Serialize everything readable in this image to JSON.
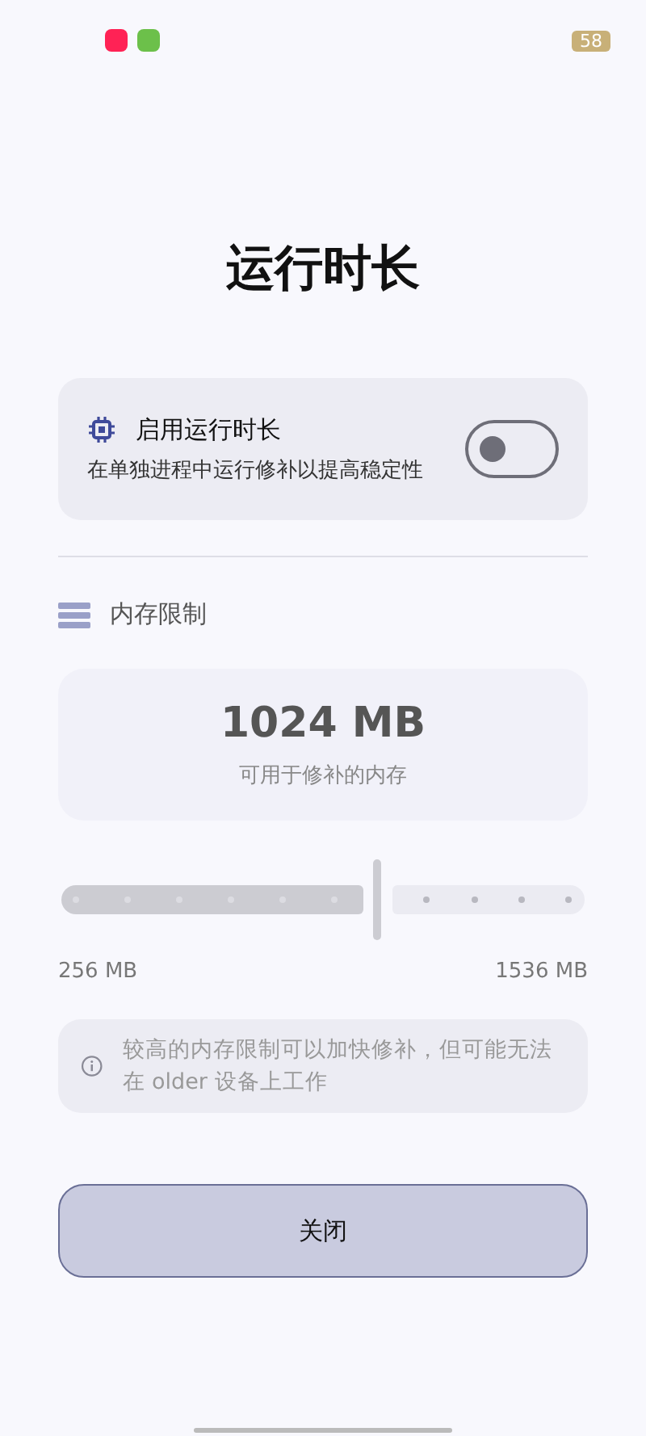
{
  "status_bar": {
    "battery": "58"
  },
  "title": "运行时长",
  "runtime_card": {
    "label": "启用运行时长",
    "description": "在单独进程中运行修补以提高稳定性",
    "on": false
  },
  "memory_section": {
    "heading": "内存限制",
    "value": "1024 MB",
    "caption": "可用于修补的内存"
  },
  "slider": {
    "level": 0.6,
    "min_label": "256 MB",
    "max_label": "1536 MB"
  },
  "info": "较高的内存限制可以加快修补，但可能无法在 older 设备上工作",
  "buttons": [
    "关闭"
  ]
}
